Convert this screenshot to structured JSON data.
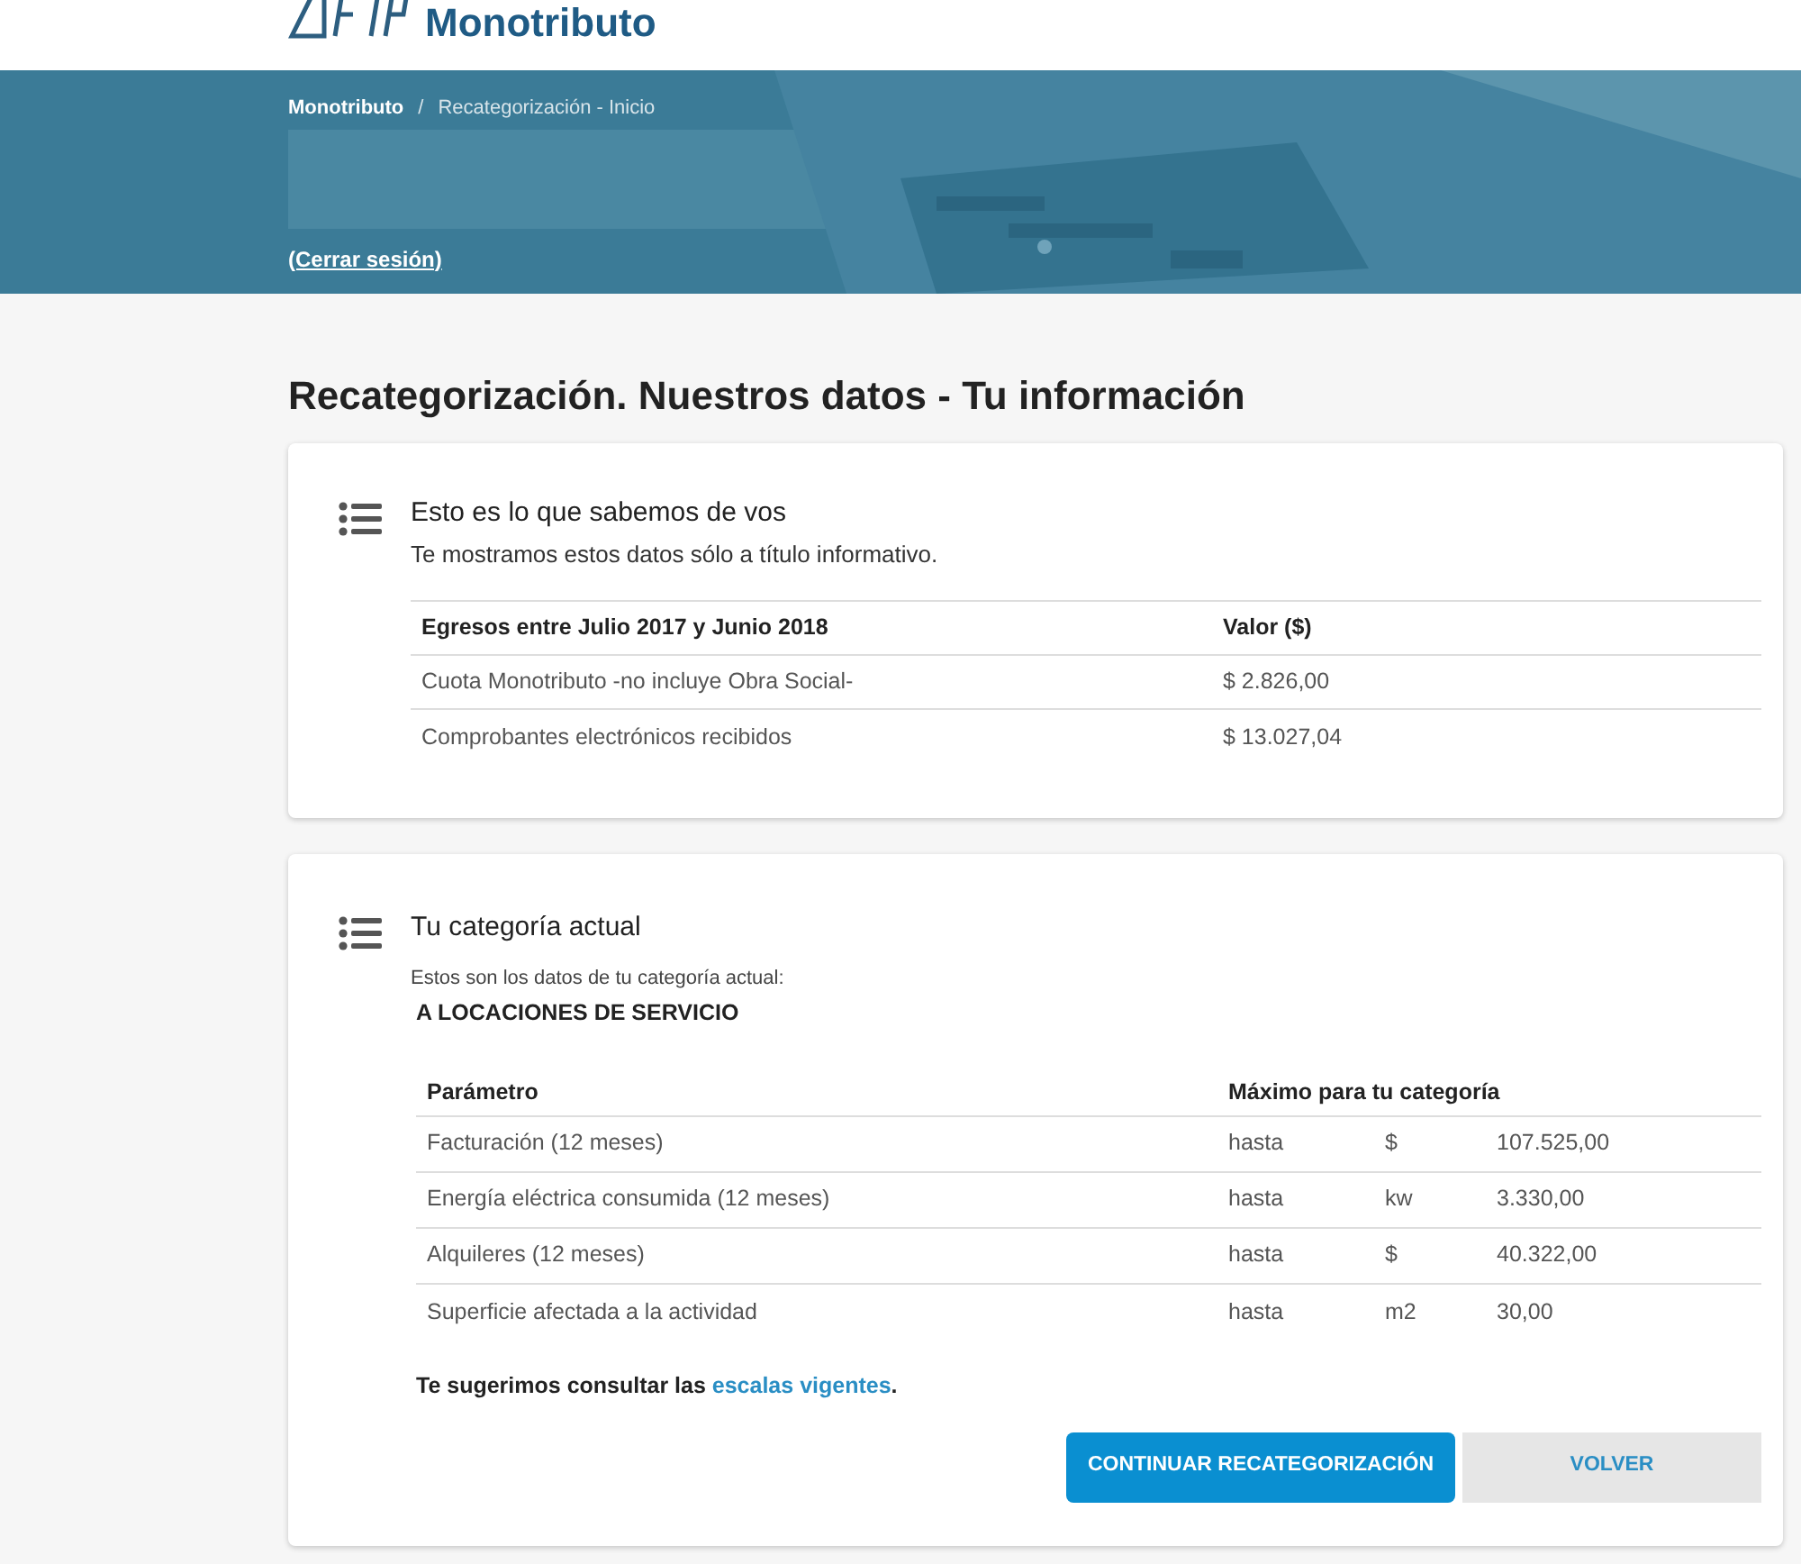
{
  "header": {
    "brand": "Monotributo"
  },
  "banner": {
    "breadcrumb": [
      {
        "label": "Monotributo",
        "selected": false
      },
      {
        "label": "Recategorización - Inicio",
        "selected": true
      }
    ],
    "separator": "/",
    "logout": "(Cerrar sesión)"
  },
  "page_title": "Recategorización. Nuestros datos - Tu información",
  "info_card": {
    "title": "Esto es lo que sabemos de vos",
    "subtitle": "Te mostramos estos datos sólo a título informativo.",
    "table": {
      "columns": [
        "Egresos entre Julio 2017 y Junio 2018",
        "Valor ($)"
      ],
      "rows": [
        [
          "Cuota Monotributo -no incluye Obra Social-",
          "$ 2.826,00"
        ],
        [
          "Comprobantes electrónicos recibidos",
          "$ 13.027,04"
        ]
      ]
    }
  },
  "category_card": {
    "title": "Tu categoría actual",
    "subtitle": "Estos son los datos de tu categoría actual:",
    "category": "A LOCACIONES DE SERVICIO",
    "table": {
      "columns": [
        "Parámetro",
        "Máximo para tu categoría"
      ],
      "rows": [
        [
          "Facturación (12 meses)",
          "hasta",
          "$",
          "107.525,00"
        ],
        [
          "Energía eléctrica consumida (12 meses)",
          "hasta",
          "kw",
          "3.330,00"
        ],
        [
          "Alquileres (12 meses)",
          "hasta",
          "$",
          "40.322,00"
        ],
        [
          "Superficie afectada a la actividad",
          "hasta",
          "m2",
          "30,00"
        ]
      ]
    },
    "hint": {
      "prefix": "Te sugerimos consultar las ",
      "link": "escalas vigentes",
      "suffix": "."
    },
    "buttons": [
      {
        "label": "CONTINUAR RECATEGORIZACIÓN",
        "kind": "primary"
      },
      {
        "label": "VOLVER",
        "kind": "secondary"
      }
    ]
  }
}
